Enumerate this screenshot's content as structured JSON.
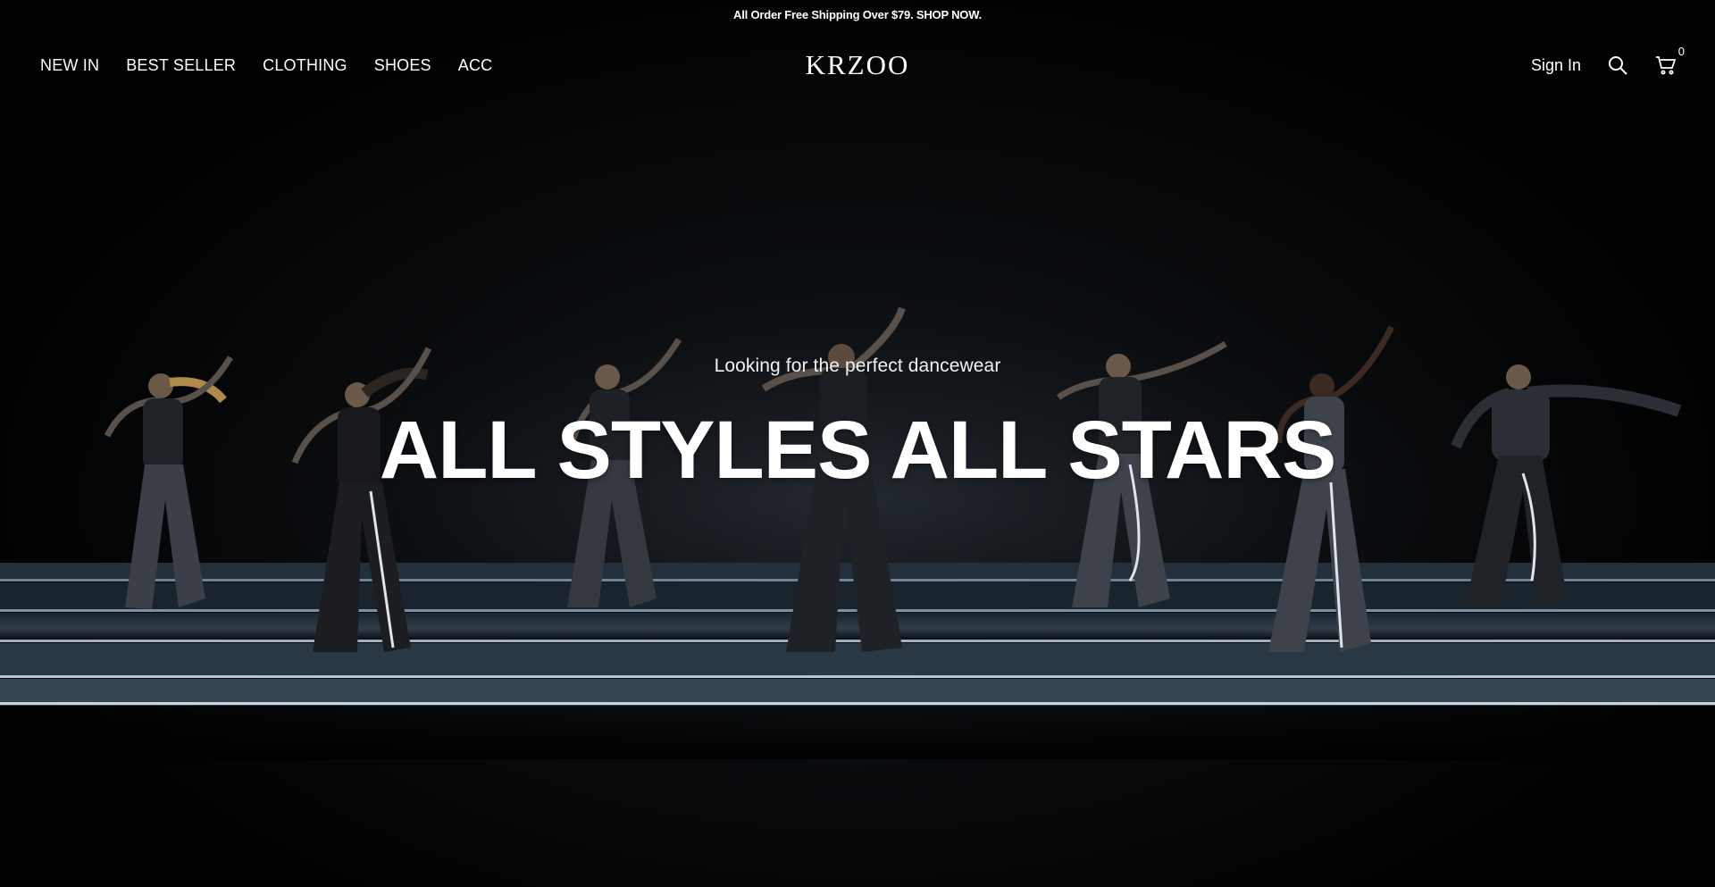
{
  "announcement": "All Order Free Shipping Over $79. SHOP NOW.",
  "nav": {
    "items": [
      "NEW IN",
      "BEST SELLER",
      "CLOTHING",
      "SHOES",
      "ACC"
    ]
  },
  "brand": {
    "logo": "KRZOO"
  },
  "tools": {
    "sign_in": "Sign In",
    "search_icon": "search-icon",
    "cart_icon": "cart-icon",
    "cart_count": "0"
  },
  "hero": {
    "subtitle": "Looking for the perfect dancewear",
    "title": "ALL STYLES ALL STARS"
  },
  "colors": {
    "background": "#000000",
    "text": "#ffffff",
    "stage_edge": "#c9d4de"
  }
}
